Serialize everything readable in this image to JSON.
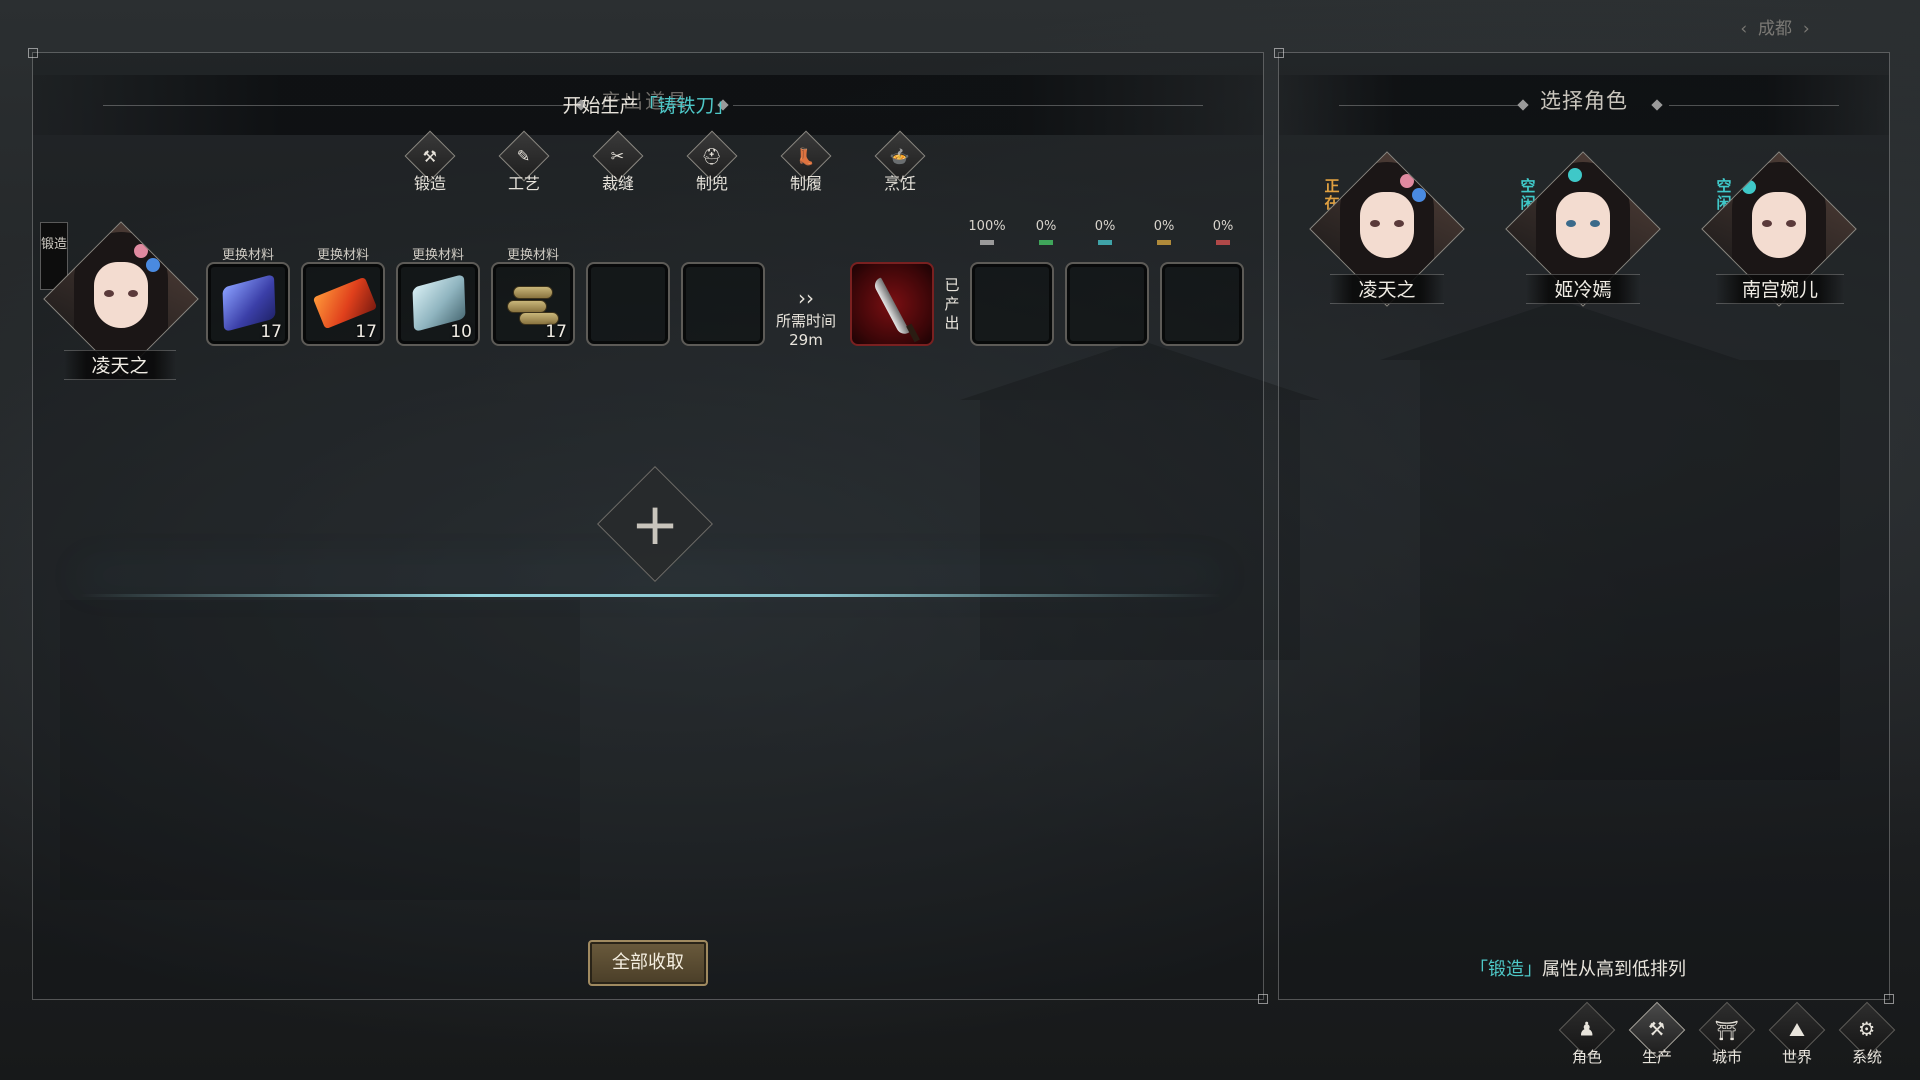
{
  "city_selector": {
    "label": "成都",
    "prev": "‹",
    "next": "›"
  },
  "left_panel": {
    "header_sub": "产出道具",
    "header_title_prefix": "开始生产",
    "header_title_item": "「铸铁刀」",
    "categories": [
      {
        "label": "锻造",
        "icon": "⚒"
      },
      {
        "label": "工艺",
        "icon": "✎"
      },
      {
        "label": "裁缝",
        "icon": "✂"
      },
      {
        "label": "制兜",
        "icon": "⛑"
      },
      {
        "label": "制履",
        "icon": "👢"
      },
      {
        "label": "烹饪",
        "icon": "🍲"
      }
    ],
    "craft_tag": "锻造",
    "character": {
      "name": "凌天之"
    },
    "materials": [
      {
        "change_label": "更换材料",
        "count": "17",
        "icon": "blue-ore-icon"
      },
      {
        "change_label": "更换材料",
        "count": "17",
        "icon": "red-ingot-icon"
      },
      {
        "change_label": "更换材料",
        "count": "10",
        "icon": "silver-ingot-icon"
      },
      {
        "change_label": "更换材料",
        "count": "17",
        "icon": "wood-logs-icon"
      }
    ],
    "time": {
      "arrows": "››",
      "label": "所需时间",
      "value": "29m"
    },
    "product": {
      "icon": "iron-blade-icon"
    },
    "produced_label": "已产出",
    "quality_rates": [
      {
        "value": "100%",
        "color": "#9a9a9a"
      },
      {
        "value": "0%",
        "color": "#3fa55a"
      },
      {
        "value": "0%",
        "color": "#3fa3a8"
      },
      {
        "value": "0%",
        "color": "#b08a3a"
      },
      {
        "value": "0%",
        "color": "#b04848"
      }
    ],
    "add_button": "+",
    "collect_all": "全部收取"
  },
  "right_panel": {
    "title": "选择角色",
    "characters": [
      {
        "name": "凌天之",
        "status": "正在锻造",
        "status_color": "#e0a040"
      },
      {
        "name": "姬冷嫣",
        "status": "空闲",
        "status_color": "#3fc8c8"
      },
      {
        "name": "南宫婉儿",
        "status": "空闲",
        "status_color": "#3fc8c8"
      }
    ],
    "sort_hint_tag": "「锻造」",
    "sort_hint_text": "属性从高到低排列"
  },
  "bottom_nav": [
    {
      "label": "角色",
      "icon": "♟"
    },
    {
      "label": "生产",
      "icon": "⚒"
    },
    {
      "label": "城市",
      "icon": "⛩"
    },
    {
      "label": "世界",
      "icon": "⛰"
    },
    {
      "label": "系统",
      "icon": "⚙"
    }
  ]
}
